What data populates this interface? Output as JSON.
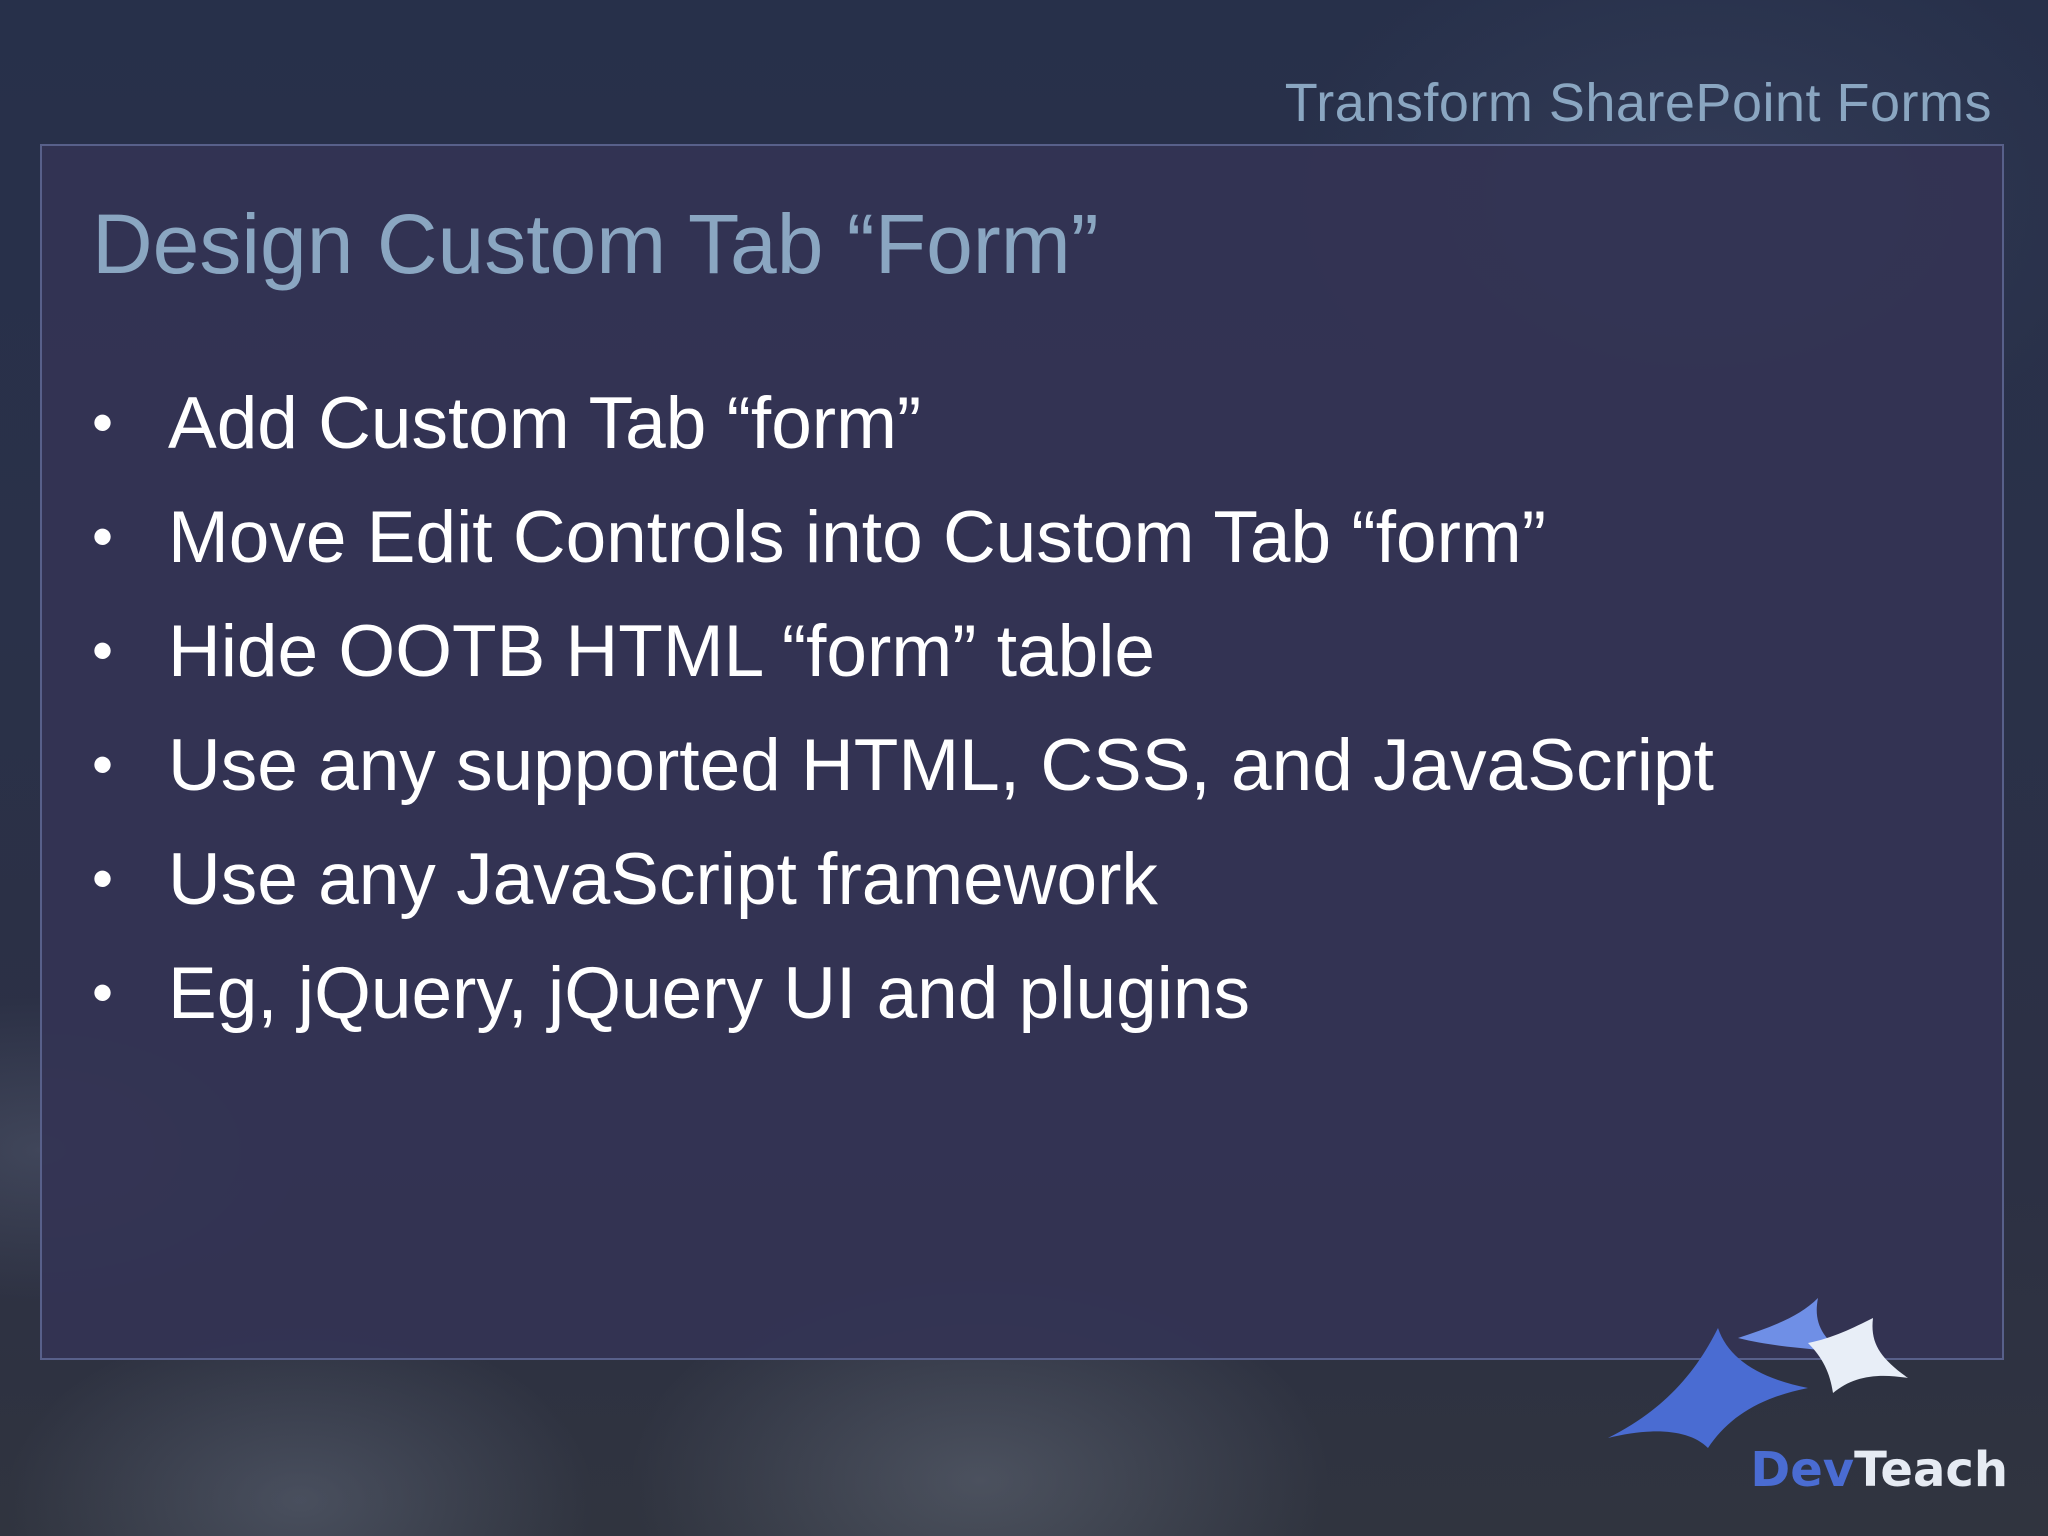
{
  "header": {
    "presentation_title": "Transform SharePoint Forms"
  },
  "slide": {
    "title": "Design Custom Tab “Form”",
    "bullet_glyph": "•",
    "bullets": [
      "Add Custom Tab “form”",
      "Move Edit Controls into Custom Tab “form”",
      "Hide OOTB HTML “form” table",
      "Use any supported HTML, CSS, and JavaScript",
      "Use any JavaScript framework",
      "Eg, jQuery, jQuery UI and plugins"
    ]
  },
  "logo": {
    "text_part1": "Dev",
    "text_part2": "Teach",
    "icon": "star-swoosh-icon"
  },
  "colors": {
    "accent_title": "#8aa6c1",
    "panel": "#343454",
    "text": "#ffffff",
    "logo_blue": "#4a6cd2"
  }
}
